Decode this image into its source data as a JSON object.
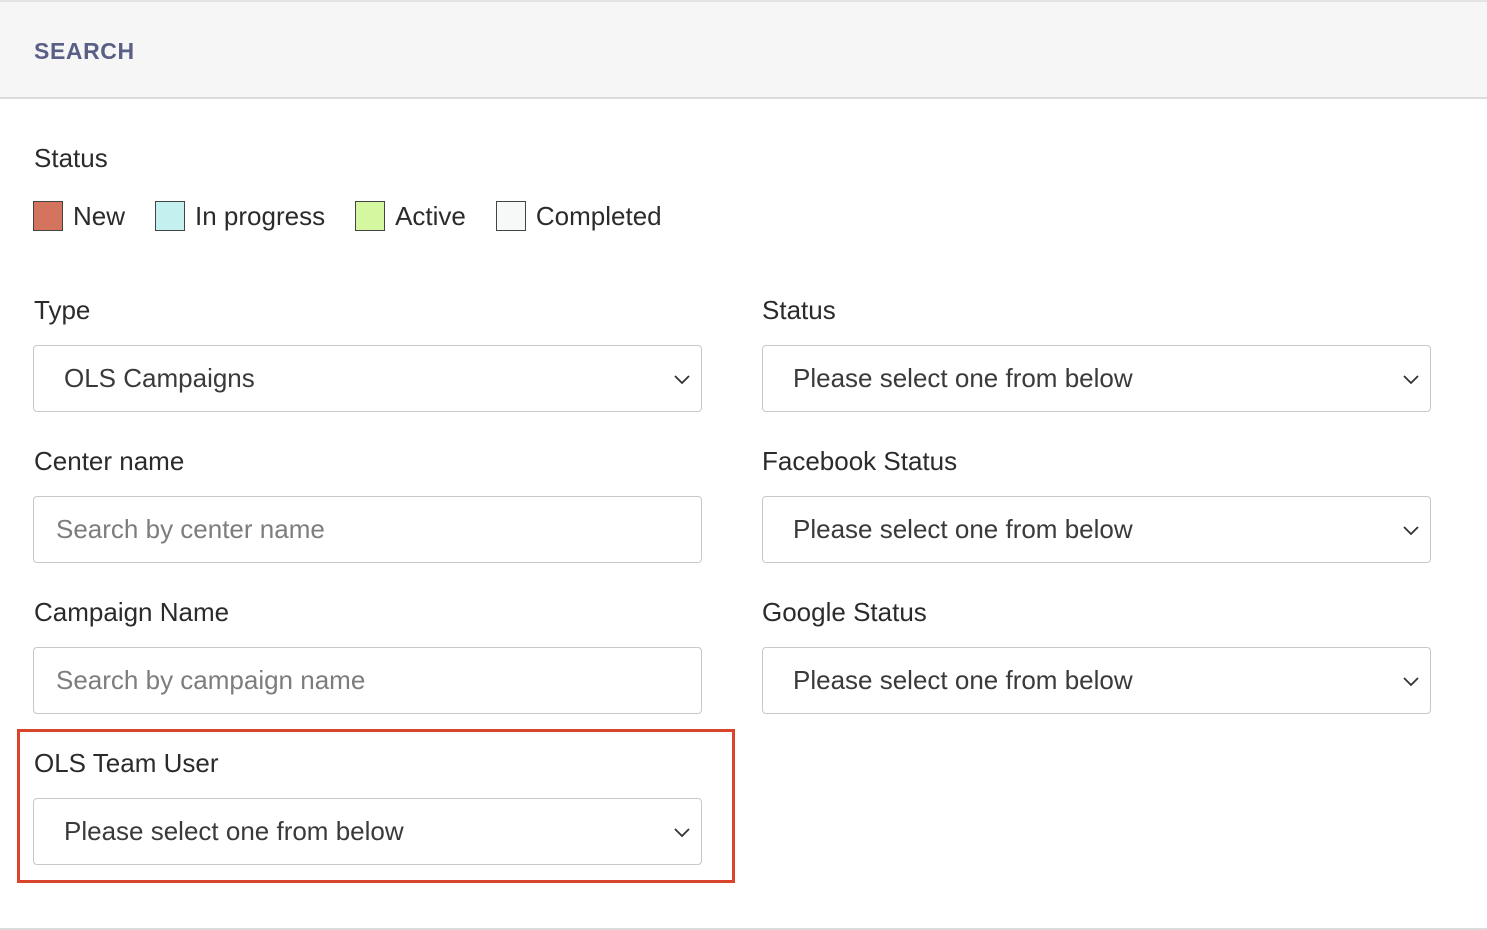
{
  "header": {
    "title": "SEARCH"
  },
  "legend": {
    "title": "Status",
    "items": [
      {
        "label": "New",
        "color": "#d4735e",
        "name": "new"
      },
      {
        "label": "In progress",
        "color": "#c4f0f0",
        "name": "in-progress"
      },
      {
        "label": "Active",
        "color": "#d4f7a0",
        "name": "active"
      },
      {
        "label": "Completed",
        "color": "#f7f9f8",
        "name": "completed"
      }
    ]
  },
  "filters": {
    "type": {
      "label": "Type",
      "value": "OLS Campaigns"
    },
    "status": {
      "label": "Status",
      "value": "Please select one from below"
    },
    "center_name": {
      "label": "Center name",
      "value": "",
      "placeholder": "Search by center name"
    },
    "facebook_status": {
      "label": "Facebook Status",
      "value": "Please select one from below"
    },
    "campaign_name": {
      "label": "Campaign Name",
      "value": "",
      "placeholder": "Search by campaign name"
    },
    "google_status": {
      "label": "Google Status",
      "value": "Please select one from below"
    },
    "ols_team_user": {
      "label": "OLS Team User",
      "value": "Please select one from below"
    }
  },
  "colors": {
    "header_title": "#5a5f86",
    "highlight": "#d9442c"
  },
  "icons": {
    "select_arrow": "chevron-down-icon"
  }
}
